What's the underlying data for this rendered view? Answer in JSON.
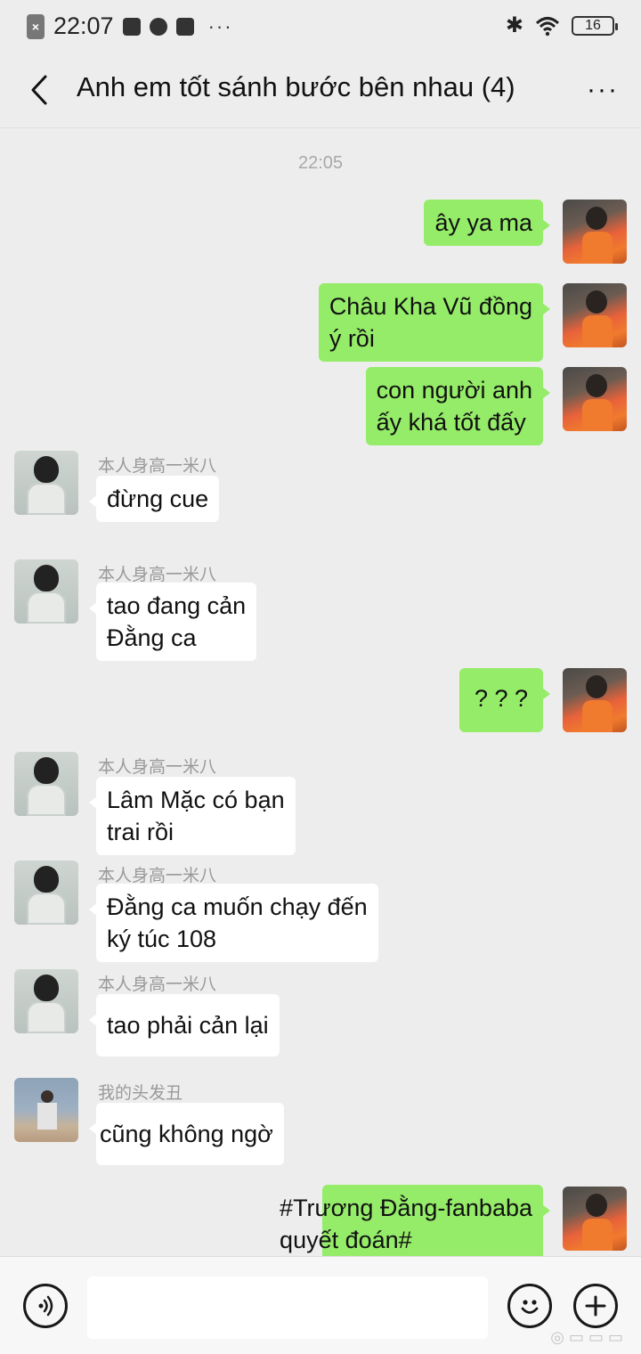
{
  "status_bar": {
    "time": "22:07",
    "battery": "16"
  },
  "header": {
    "title": "Anh em tốt sánh bước bên nhau (4)",
    "more_label": "···"
  },
  "timestamp": "22:05",
  "messages": [
    {
      "side": "out",
      "lines": [
        "ây ya ma"
      ]
    },
    {
      "side": "out",
      "lines": [
        "Châu Kha Vũ đồng",
        "ý rồi"
      ]
    },
    {
      "side": "out",
      "lines": [
        "con người anh",
        "ấy khá tốt đấy"
      ]
    },
    {
      "side": "in",
      "sender": "本人身高一米八",
      "lines": [
        "đừng cue"
      ]
    },
    {
      "side": "in",
      "sender": "本人身高一米八",
      "lines": [
        "tao đang cản",
        "Đằng ca"
      ]
    },
    {
      "side": "out",
      "lines": [
        "? ? ?"
      ]
    },
    {
      "side": "in",
      "sender": "本人身高一米八",
      "lines": [
        "Lâm Mặc có bạn",
        "trai rồi"
      ]
    },
    {
      "side": "in",
      "sender": "本人身高一米八",
      "lines": [
        "Đằng ca muốn chạy đến",
        "ký túc 108"
      ]
    },
    {
      "side": "in",
      "sender": "本人身高一米八",
      "lines": [
        "tao phải cản lại"
      ]
    },
    {
      "side": "in",
      "sender": "我的头发丑",
      "lines": [
        "cũng không ngờ"
      ]
    },
    {
      "side": "out",
      "lines": [
        "#Trương Đằng-fanbaba",
        "quyết đoán#"
      ]
    }
  ],
  "icons": {
    "back": "chevron-left-icon",
    "more": "ellipsis-icon",
    "voice": "voice-icon",
    "emoji": "smiley-icon",
    "plus": "plus-icon"
  },
  "colors": {
    "outgoing_bubble": "#95ec69",
    "incoming_bubble": "#ffffff",
    "background": "#ededed"
  }
}
